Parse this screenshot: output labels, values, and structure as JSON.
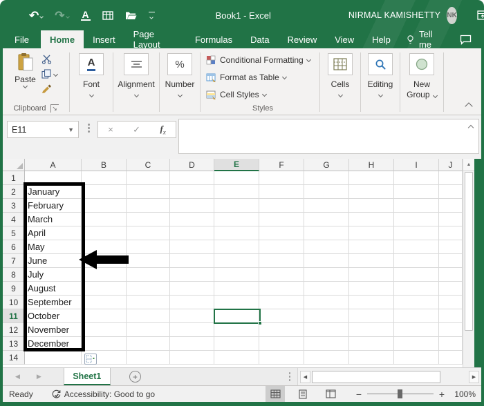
{
  "titlebar": {
    "title": "Book1 - Excel",
    "user_name": "NIRMAL KAMISHETTY",
    "avatar_initials": "NK"
  },
  "tabs": {
    "items": [
      "File",
      "Home",
      "Insert",
      "Page Layout",
      "Formulas",
      "Data",
      "Review",
      "View",
      "Help"
    ],
    "active": "Home",
    "tell_me": "Tell me"
  },
  "ribbon": {
    "paste": "Paste",
    "clipboard_group": "Clipboard",
    "font": "Font",
    "alignment": "Alignment",
    "number": "Number",
    "number_glyph": "%",
    "conditional_formatting": "Conditional Formatting",
    "format_as_table": "Format as Table",
    "cell_styles": "Cell Styles",
    "styles_group": "Styles",
    "cells": "Cells",
    "editing": "Editing",
    "new_group_line1": "New",
    "new_group_line2": "Group",
    "font_glyph": "A"
  },
  "formula_bar": {
    "name_box": "E11",
    "cancel_glyph": "×",
    "enter_glyph": "✓",
    "fx_f": "f",
    "fx_x": "x",
    "value": ""
  },
  "grid": {
    "column_headers": [
      "A",
      "B",
      "C",
      "D",
      "E",
      "F",
      "G",
      "H",
      "I",
      "J"
    ],
    "row_headers": [
      "1",
      "2",
      "3",
      "4",
      "5",
      "6",
      "7",
      "8",
      "9",
      "10",
      "11",
      "12",
      "13",
      "14"
    ],
    "selected_cell": "E11",
    "selected_column": "E",
    "selected_row": "11",
    "months_start_row": 2,
    "months": [
      "January",
      "February",
      "March",
      "April",
      "May",
      "June",
      "July",
      "August",
      "September",
      "October",
      "November",
      "December"
    ]
  },
  "sheet_bar": {
    "active_tab": "Sheet1"
  },
  "status_bar": {
    "mode": "Ready",
    "accessibility": "Accessibility: Good to go",
    "zoom": "100%"
  },
  "colors": {
    "excel_green": "#217346",
    "annotation": "#000000"
  }
}
